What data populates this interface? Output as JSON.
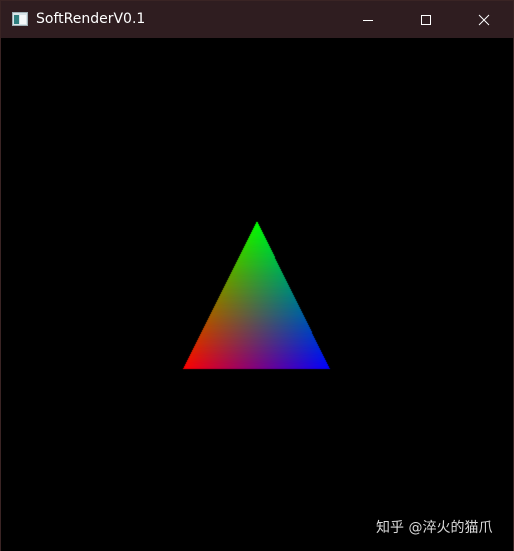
{
  "window": {
    "title": "SoftRenderV0.1",
    "icon": "app-window-icon",
    "controls": {
      "minimize_icon": "minimize-icon",
      "maximize_icon": "maximize-icon",
      "close_icon": "close-icon"
    }
  },
  "scene": {
    "background_color": "#000000",
    "triangle": {
      "vertex_colors": {
        "top": "#00ff00",
        "bottom_left": "#ff0000",
        "bottom_right": "#0000ff"
      }
    }
  },
  "watermark": {
    "text": "知乎 @淬火的猫爪"
  },
  "colors": {
    "titlebar": "#2f1d20",
    "title_text": "#ffffff"
  }
}
